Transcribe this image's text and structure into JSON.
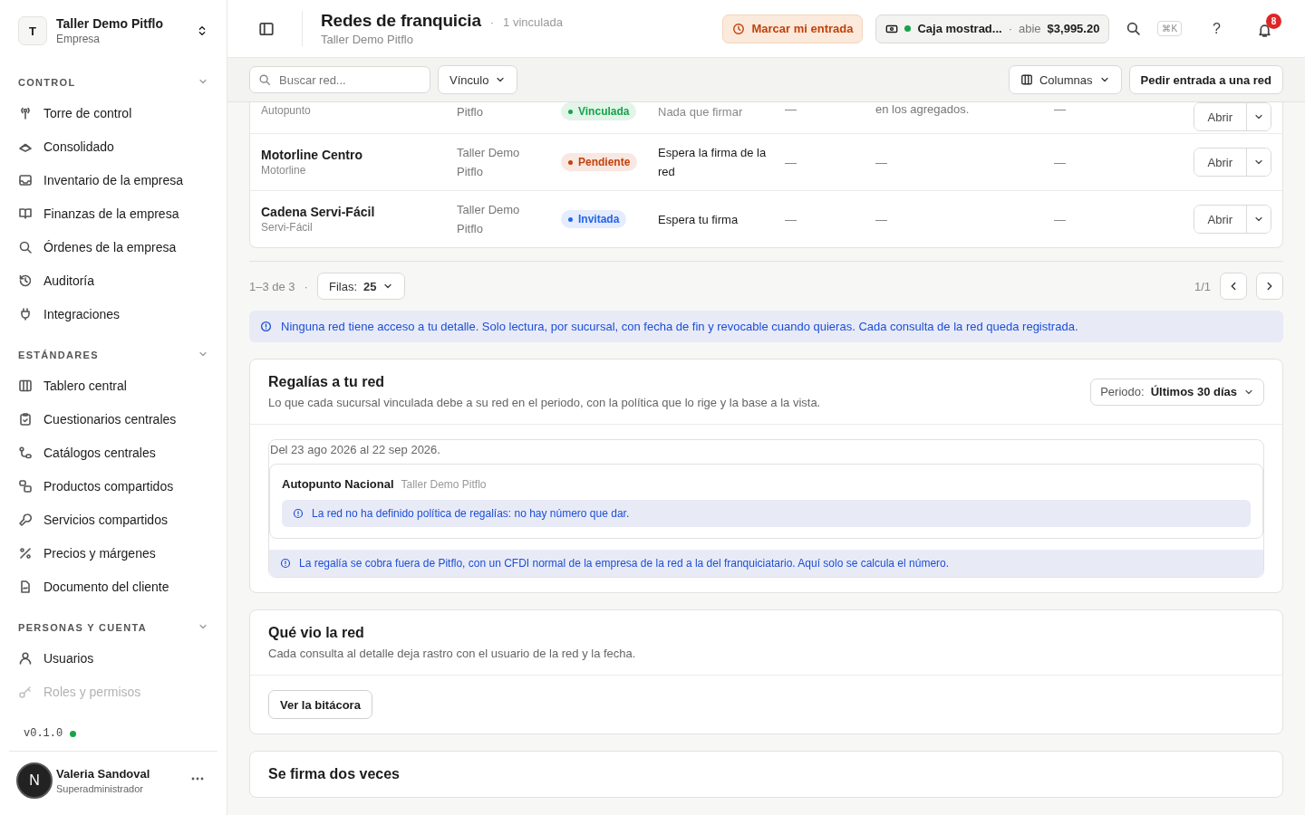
{
  "sidebar": {
    "org": {
      "initial": "T",
      "name": "Taller Demo Pitflo",
      "role": "Empresa"
    },
    "sections": [
      {
        "title": "CONTROL",
        "expanded": true,
        "items": [
          {
            "label": "Torre de control"
          },
          {
            "label": "Consolidado"
          },
          {
            "label": "Inventario de la empresa"
          },
          {
            "label": "Finanzas de la empresa"
          },
          {
            "label": "Órdenes de la empresa"
          },
          {
            "label": "Auditoría"
          },
          {
            "label": "Integraciones"
          }
        ]
      },
      {
        "title": "ESTÁNDARES",
        "expanded": true,
        "items": [
          {
            "label": "Tablero central"
          },
          {
            "label": "Cuestionarios centrales"
          },
          {
            "label": "Catálogos centrales"
          },
          {
            "label": "Productos compartidos"
          },
          {
            "label": "Servicios compartidos"
          },
          {
            "label": "Precios y márgenes"
          },
          {
            "label": "Documento del cliente"
          }
        ]
      },
      {
        "title": "PERSONAS Y CUENTA",
        "expanded": true,
        "items": [
          {
            "label": "Usuarios"
          },
          {
            "label": "Roles y permisos"
          }
        ]
      }
    ],
    "version": "v0.1.0",
    "user": {
      "initial": "N",
      "name": "Valeria Sandoval",
      "role": "Superadministrador"
    }
  },
  "header": {
    "title": "Redes de franquicia",
    "count_separator": "·",
    "count": "1 vinculada",
    "subtitle": "Taller Demo Pitflo",
    "clock_button": "Marcar mi entrada",
    "register": {
      "name": "Caja mostrad...",
      "separator": "·",
      "status": "abie",
      "amount": "$3,995.20"
    },
    "shortcut": "⌘K",
    "help": "?",
    "notifications": "8"
  },
  "toolbar": {
    "search": {
      "placeholder": "Buscar red..."
    },
    "filter": "Vínculo",
    "columns_button": "Columnas",
    "request_button": "Pedir entrada a una red"
  },
  "table": {
    "rows": [
      {
        "short": "Autopunto",
        "branch": "Pitflo",
        "status": {
          "label": "Vinculada",
          "color": "#16a34a"
        },
        "signature": "Nada que firmar",
        "column_5": "—",
        "column_6": "en los agregados.",
        "column_7": "—",
        "action": "Abrir"
      },
      {
        "name": "Motorline Centro",
        "short": "Motorline",
        "branch": "Taller Demo Pitflo",
        "status": {
          "label": "Pendiente",
          "color": "#c2410c"
        },
        "signature": "Espera la firma de la red",
        "column_5": "—",
        "column_6": "—",
        "column_7": "—",
        "action": "Abrir"
      },
      {
        "name": "Cadena Servi-Fácil",
        "short": "Servi-Fácil",
        "branch": "Taller Demo Pitflo",
        "status": {
          "label": "Invitada",
          "color": "#2563eb"
        },
        "signature": "Espera tu firma",
        "column_5": "—",
        "column_6": "—",
        "column_7": "—",
        "action": "Abrir"
      }
    ]
  },
  "pagination": {
    "range": "1–3 de 3",
    "separator": "·",
    "rows_label": "Filas:",
    "rows_value": "25",
    "page": "1/1"
  },
  "notice": "Ninguna red tiene acceso a tu detalle. Solo lectura, por sucursal, con fecha de fin y revocable cuando quieras. Cada consulta de la red queda registrada.",
  "royalties": {
    "title": "Regalías a tu red",
    "description": "Lo que cada sucursal vinculada debe a su red en el periodo, con la política que lo rige y la base a la vista.",
    "period_label": "Periodo:",
    "period_value": "Últimos 30 días",
    "range": "Del 23 ago 2026 al 22 sep 2026.",
    "networks": [
      {
        "name": "Autopunto Nacional",
        "company": "Taller Demo Pitflo",
        "notice": "La red no ha definido política de regalías: no hay número que dar."
      }
    ],
    "footnote": "La regalía se cobra fuera de Pitflo, con un CFDI normal de la empresa de la red a la del franquiciatario. Aquí solo se calcula el número."
  },
  "audit": {
    "title": "Qué vio la red",
    "description": "Cada consulta al detalle deja rastro con el usuario de la red y la fecha.",
    "button": "Ver la bitácora"
  },
  "signing": {
    "title": "Se firma dos veces"
  }
}
